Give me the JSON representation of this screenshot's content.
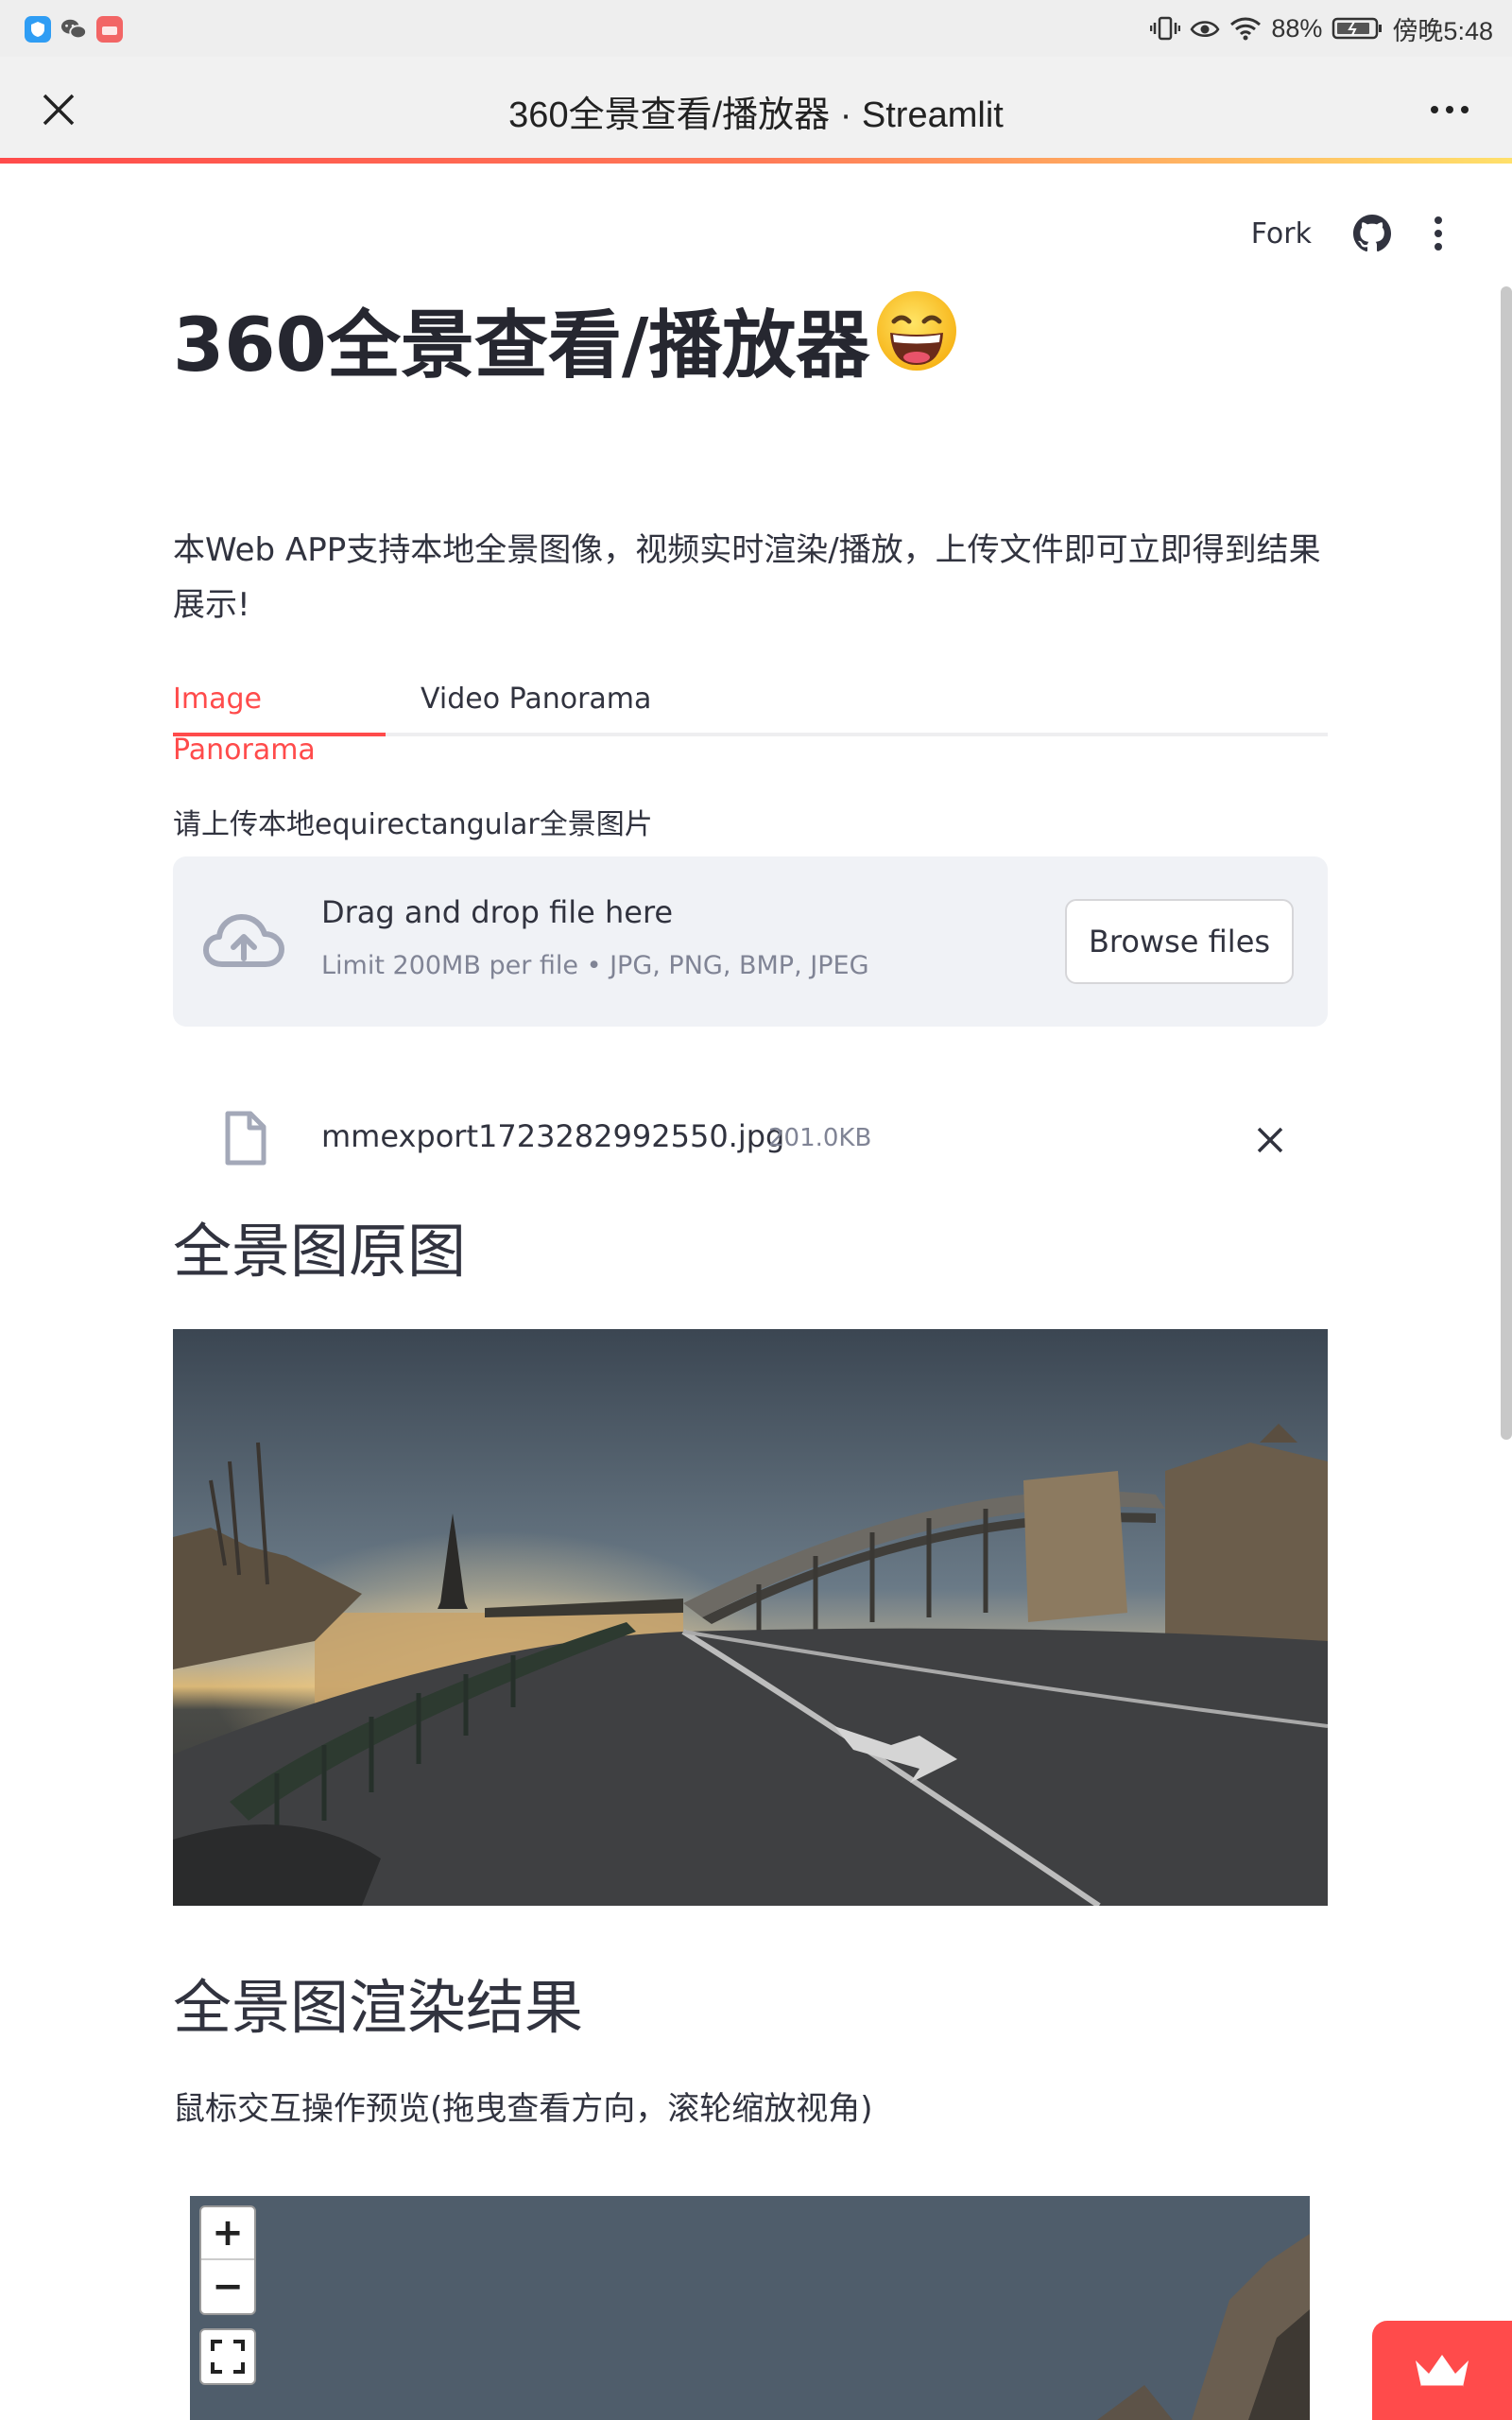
{
  "status_bar": {
    "battery": "88%",
    "time": "傍晚5:48"
  },
  "browser": {
    "title": "360全景查看/播放器 · Streamlit"
  },
  "header": {
    "fork_label": "Fork"
  },
  "page": {
    "title": "360全景查看/播放器",
    "title_emoji": "😄",
    "description": "本Web APP支持本地全景图像，视频实时渲染/播放，上传文件即可立即得到结果展示!"
  },
  "tabs": [
    {
      "label": "Image Panorama",
      "active": true
    },
    {
      "label": "Video Panorama",
      "active": false
    }
  ],
  "uploader": {
    "label": "请上传本地equirectangular全景图片",
    "drop_text": "Drag and drop file here",
    "limit_text": "Limit 200MB per file • JPG, PNG, BMP, JPEG",
    "browse_label": "Browse files"
  },
  "uploaded_file": {
    "name": "mmexport1723282992550.jpg",
    "size": "201.0KB"
  },
  "sections": {
    "original_heading": "全景图原图",
    "render_heading": "全景图渲染结果",
    "render_caption": "鼠标交互操作预览(拖曳查看方向，滚轮缩放视角)"
  },
  "viewer": {
    "zoom_in": "+",
    "zoom_out": "−"
  },
  "colors": {
    "accent": "#ff4b4b",
    "text": "#31333f",
    "muted": "#808495",
    "dropzone_bg": "#f0f2f6"
  }
}
